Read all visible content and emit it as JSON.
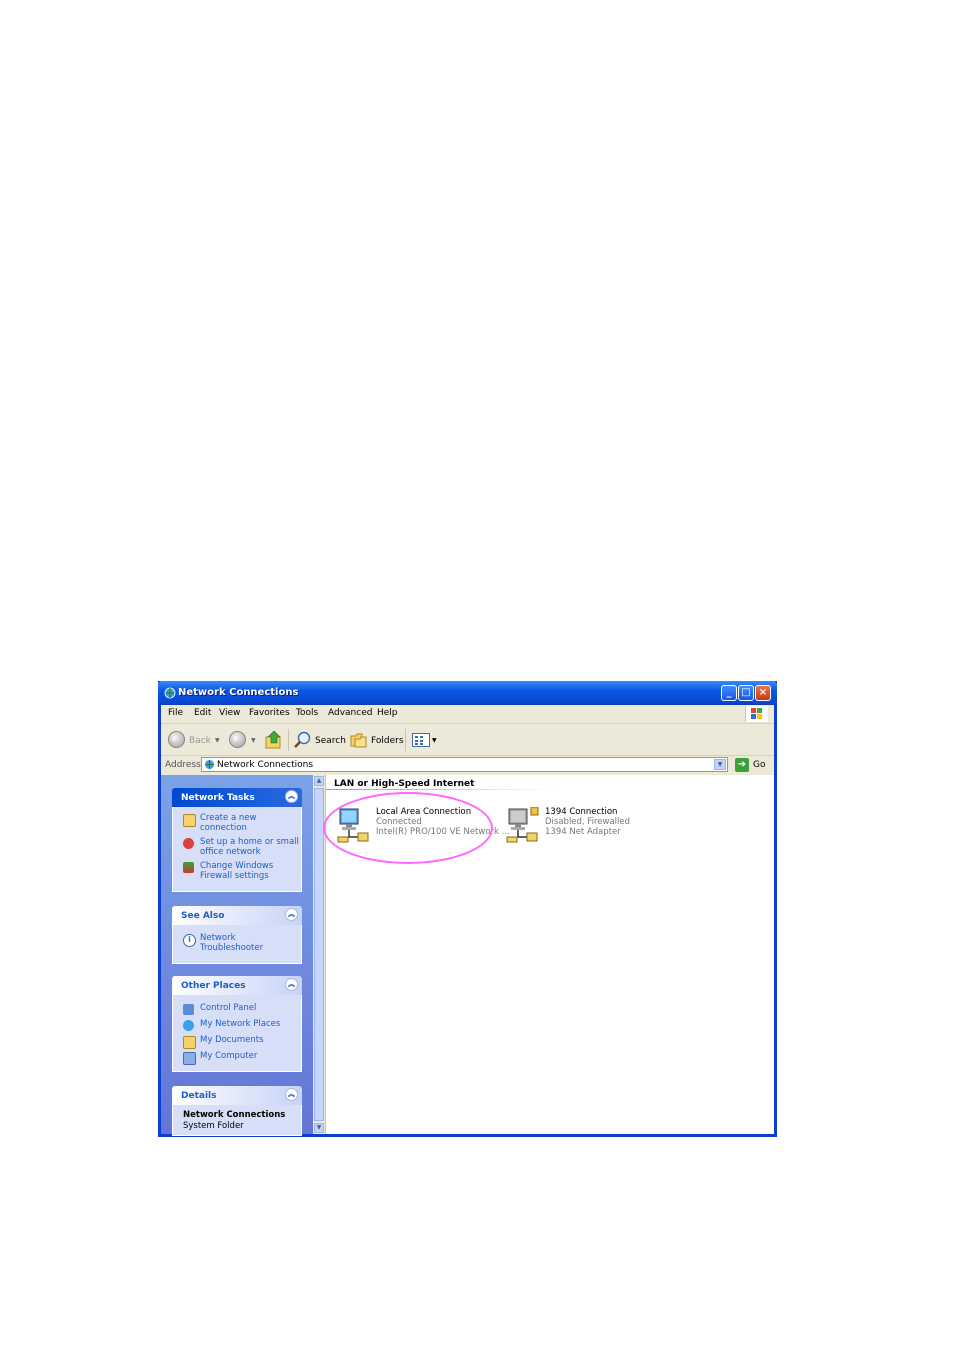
{
  "window": {
    "title": "Network Connections"
  },
  "menu": [
    "File",
    "Edit",
    "View",
    "Favorites",
    "Tools",
    "Advanced",
    "Help"
  ],
  "toolbar": {
    "back_label": "Back",
    "search_label": "Search",
    "folders_label": "Folders"
  },
  "address": {
    "label": "Address",
    "value": "Network Connections",
    "go_label": "Go"
  },
  "sidebar": {
    "network_tasks": {
      "title": "Network Tasks",
      "items": [
        "Create a new connection",
        "Set up a home or small office network",
        "Change Windows Firewall settings"
      ]
    },
    "see_also": {
      "title": "See Also",
      "items": [
        "Network Troubleshooter"
      ]
    },
    "other_places": {
      "title": "Other Places",
      "items": [
        "Control Panel",
        "My Network Places",
        "My Documents",
        "My Computer"
      ]
    },
    "details": {
      "title": "Details",
      "name": "Network Connections",
      "type": "System Folder"
    }
  },
  "content": {
    "group_title": "LAN or High-Speed Internet",
    "connections": [
      {
        "name": "Local Area Connection",
        "status": "Connected",
        "device": "Intel(R) PRO/100 VE Network ..."
      },
      {
        "name": "1394 Connection",
        "status": "Disabled, Firewalled",
        "device": "1394 Net Adapter"
      }
    ]
  },
  "colors": {
    "title_blue": "#0a56e6",
    "link_blue": "#215dc6",
    "highlight_circle": "#ff66ff"
  }
}
